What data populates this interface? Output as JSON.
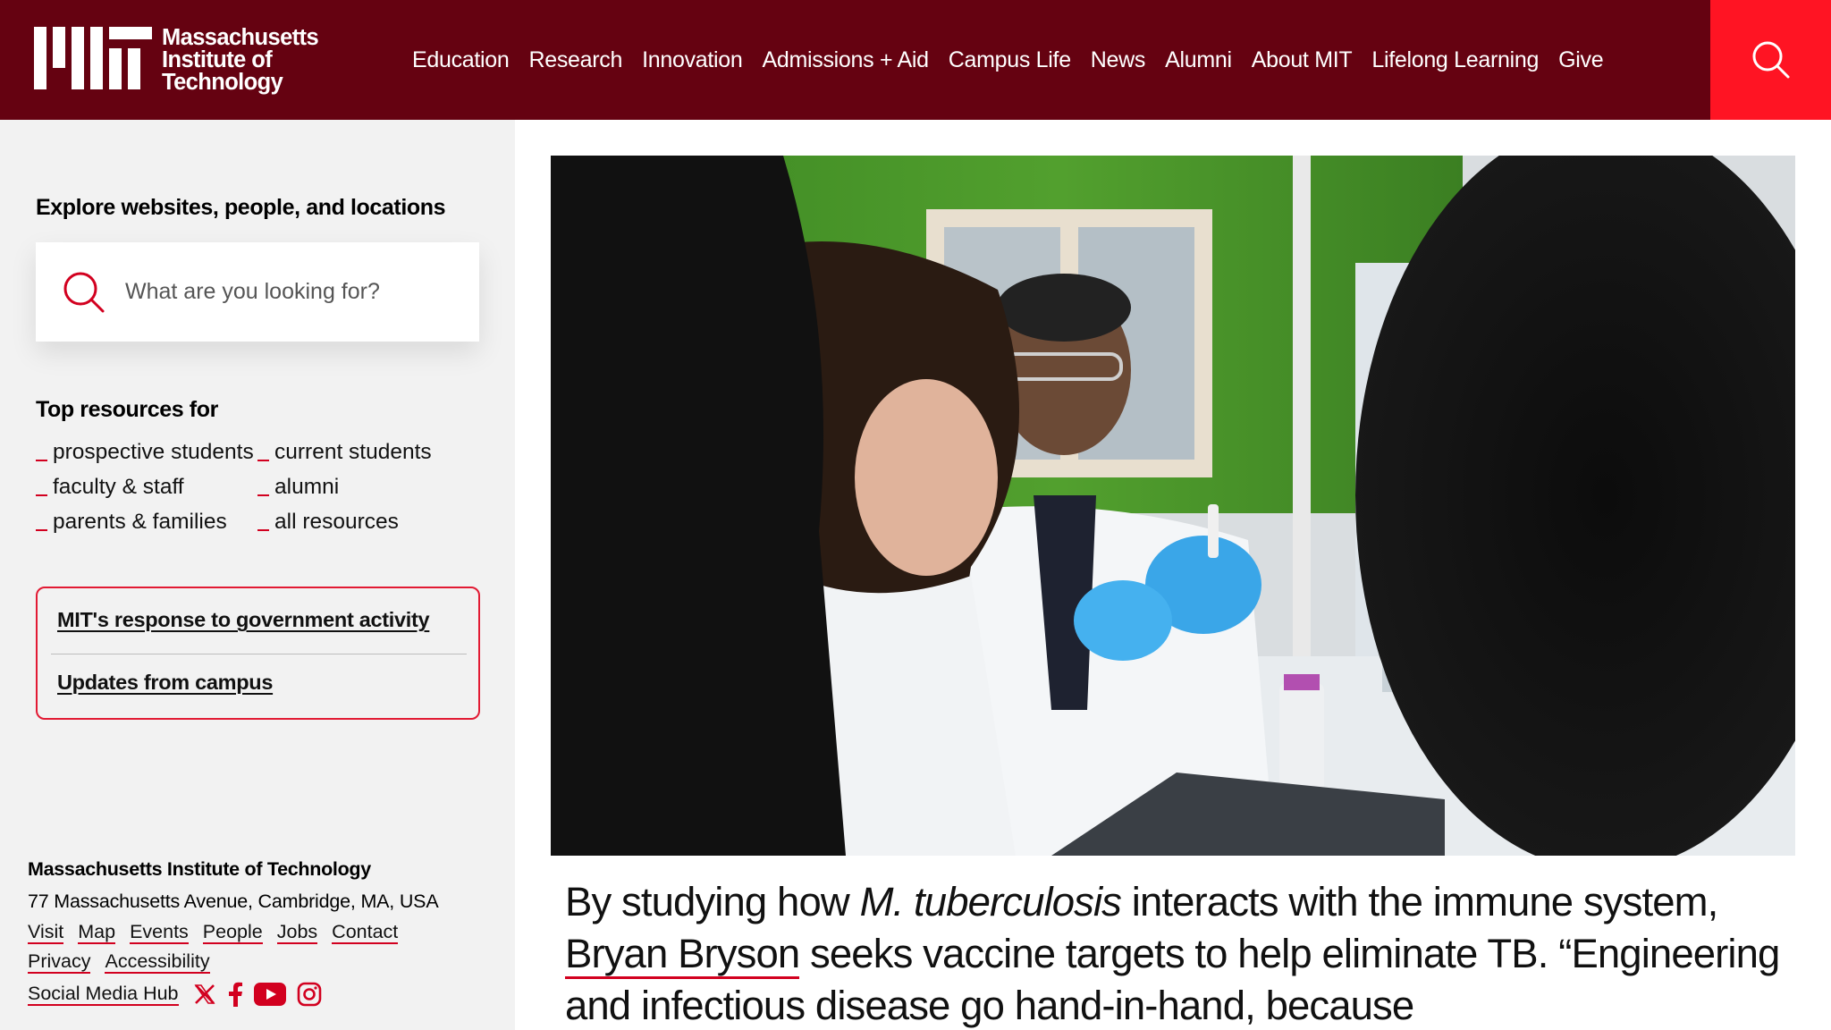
{
  "header": {
    "logo_lines": [
      "Massachusetts",
      "Institute of",
      "Technology"
    ],
    "nav": [
      "Education",
      "Research",
      "Innovation",
      "Admissions + Aid",
      "Campus Life",
      "News",
      "Alumni",
      "About MIT",
      "Lifelong Learning",
      "Give"
    ],
    "search_icon": "search-icon",
    "colors": {
      "bar": "#650211",
      "search_button": "#ff1423"
    }
  },
  "sidebar": {
    "explore_title": "Explore websites, people, and locations",
    "search_placeholder": "What are you looking for?",
    "top_resources_title": "Top resources for",
    "resources": [
      "prospective students",
      "current students",
      "faculty & staff",
      "alumni",
      "parents & families",
      "all resources"
    ],
    "alerts": [
      "MIT's response to government activity",
      "Updates from campus"
    ],
    "footer": {
      "name": "Massachusetts Institute of Technology",
      "address": "77 Massachusetts Avenue, Cambridge, MA, USA",
      "links": [
        "Visit",
        "Map",
        "Events",
        "People",
        "Jobs",
        "Contact",
        "Privacy",
        "Accessibility"
      ],
      "social_hub": "Social Media Hub",
      "social_icons": [
        "x-icon",
        "facebook-icon",
        "youtube-icon",
        "instagram-icon"
      ]
    }
  },
  "main": {
    "caption": {
      "part1": "By studying how ",
      "italic": "M. tuberculosis",
      "part2": " interacts with the immune system, ",
      "person": "Bryan Bryson",
      "part3": " seeks vaccine targets to help eliminate TB. “Engineering and infectious disease go hand-in-hand, because"
    }
  },
  "colors": {
    "accent": "#d2001f",
    "sidebar_bg": "#f2f2f2"
  }
}
